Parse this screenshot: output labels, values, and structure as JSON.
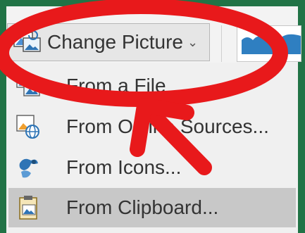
{
  "ribbon": {
    "change_picture_label": "Change Picture"
  },
  "menu": {
    "items": [
      {
        "label": "From a File",
        "icon": "picture-file-icon"
      },
      {
        "label": "From Online Sources...",
        "icon": "online-picture-icon"
      },
      {
        "label": "From Icons...",
        "icon": "shapes-icon"
      },
      {
        "label": "From Clipboard...",
        "icon": "clipboard-icon"
      }
    ],
    "selected_index": 3
  },
  "colors": {
    "frame_green": "#217346",
    "annotation_red": "#e8191b",
    "selected_bg": "#c8c8c8"
  }
}
